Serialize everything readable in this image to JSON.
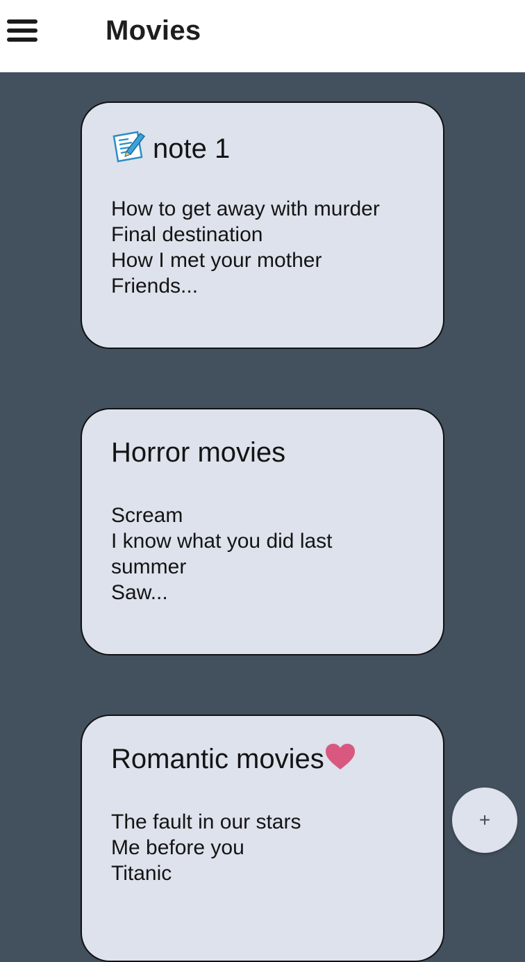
{
  "header": {
    "menu_icon": "hamburger-menu-icon",
    "title": "Movies"
  },
  "notes": [
    {
      "title": "note 1",
      "icon": "memo-icon",
      "lines": [
        "How to get away with murder",
        "Final destination",
        "How I met your mother",
        "Friends..."
      ]
    },
    {
      "title": "Horror movies",
      "lines": [
        "Scream",
        "I know what you did last",
        "summer",
        "Saw..."
      ]
    },
    {
      "title": "Romantic movies",
      "icon": "heart-icon",
      "lines": [
        "The fault in our stars",
        "Me before you",
        "Titanic"
      ]
    }
  ],
  "fab": {
    "label": "+",
    "icon": "add-icon"
  },
  "colors": {
    "background": "#43505e",
    "app_bar": "#ffffff",
    "card": "#dde2ec",
    "heart": "#d9587f",
    "memo_accent": "#2a8fc7"
  }
}
